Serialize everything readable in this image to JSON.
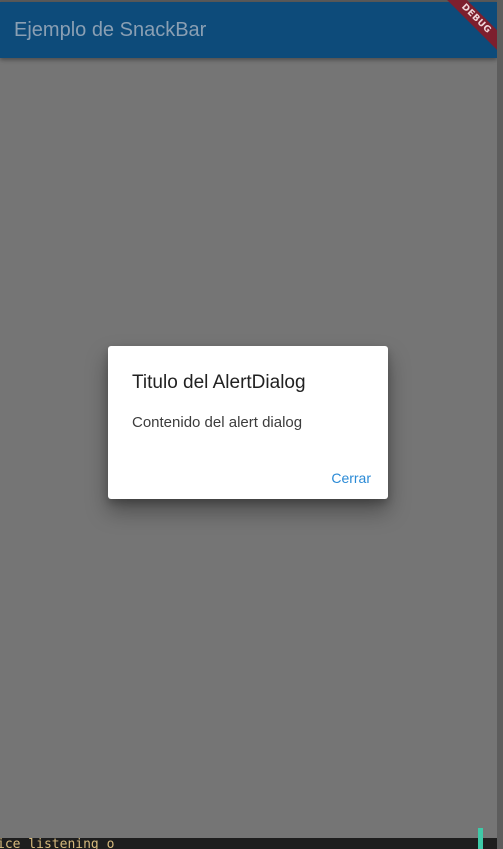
{
  "appbar": {
    "title": "Ejemplo de SnackBar"
  },
  "debug_banner": {
    "label": "DEBUG"
  },
  "dialog": {
    "title": "Titulo del AlertDialog",
    "content": "Contenido del alert dialog",
    "action_label": "Cerrar"
  },
  "terminal": {
    "text": "ice listening o"
  },
  "colors": {
    "appbar_bg": "#0d4b7a",
    "scrim_bg": "#757575",
    "accent": "#2a8ad6",
    "debug_ribbon": "#7d1f2e"
  }
}
